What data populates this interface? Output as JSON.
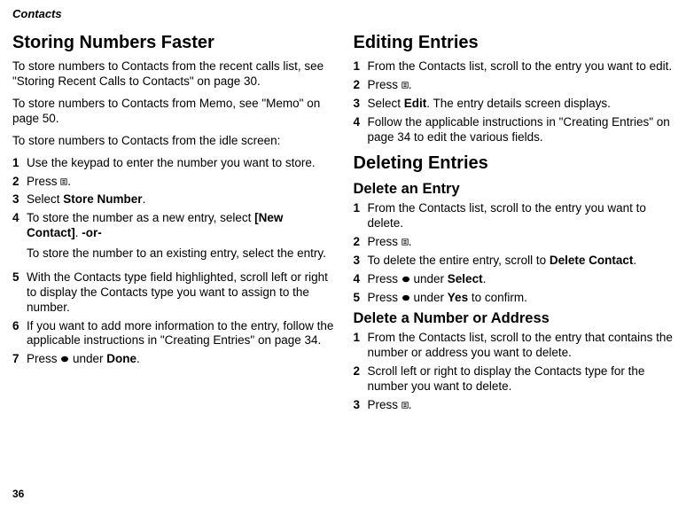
{
  "header": "Contacts",
  "page_number": "36",
  "left": {
    "h1": "Storing Numbers Faster",
    "p1": "To store numbers to Contacts from the recent calls list, see \"Storing Recent Calls to Contacts\" on page 30.",
    "p2": "To store numbers to Contacts from Memo, see \"Memo\" on page 50.",
    "p3": "To store numbers to Contacts from the idle screen:",
    "steps": {
      "s1": "Use the keypad to enter the number you want to store.",
      "s2a": "Press ",
      "s2b": ".",
      "s3a": "Select ",
      "s3b": "Store Number",
      "s3c": ".",
      "s4a": "To store the number as a new entry, select ",
      "s4b": "[New Contact]",
      "s4c": ". ",
      "s4d": "-or-",
      "s4e": "To store the number to an existing entry, select the entry.",
      "s5": "With the Contacts type field highlighted, scroll left or right to display the Contacts type you want to assign to the number.",
      "s6": "If you want to add more information to the entry, follow the applicable instructions in \"Creating Entries\" on page 34.",
      "s7a": "Press ",
      "s7b": " under ",
      "s7c": "Done",
      "s7d": "."
    }
  },
  "right": {
    "h1a": "Editing Entries",
    "edit": {
      "s1": "From the Contacts list, scroll to the entry you want to edit.",
      "s2a": "Press ",
      "s2b": ".",
      "s3a": "Select ",
      "s3b": "Edit",
      "s3c": ". The entry details screen displays.",
      "s4": "Follow the applicable instructions in \"Creating Entries\" on page 34 to edit the various fields."
    },
    "h1b": "Deleting Entries",
    "h2a": "Delete an Entry",
    "del_entry": {
      "s1": "From the Contacts list, scroll to the entry you want to delete.",
      "s2a": "Press ",
      "s2b": ".",
      "s3a": "To delete the entire entry, scroll to ",
      "s3b": "Delete Contact",
      "s3c": ".",
      "s4a": "Press ",
      "s4b": " under ",
      "s4c": "Select",
      "s4d": ".",
      "s5a": "Press ",
      "s5b": " under ",
      "s5c": "Yes",
      "s5d": " to confirm."
    },
    "h2b": "Delete a Number or Address",
    "del_num": {
      "s1": "From the Contacts list, scroll to the entry that contains the number or address you want to delete.",
      "s2": "Scroll left or right to display the Contacts type for the number you want to delete.",
      "s3a": "Press ",
      "s3b": "."
    }
  }
}
